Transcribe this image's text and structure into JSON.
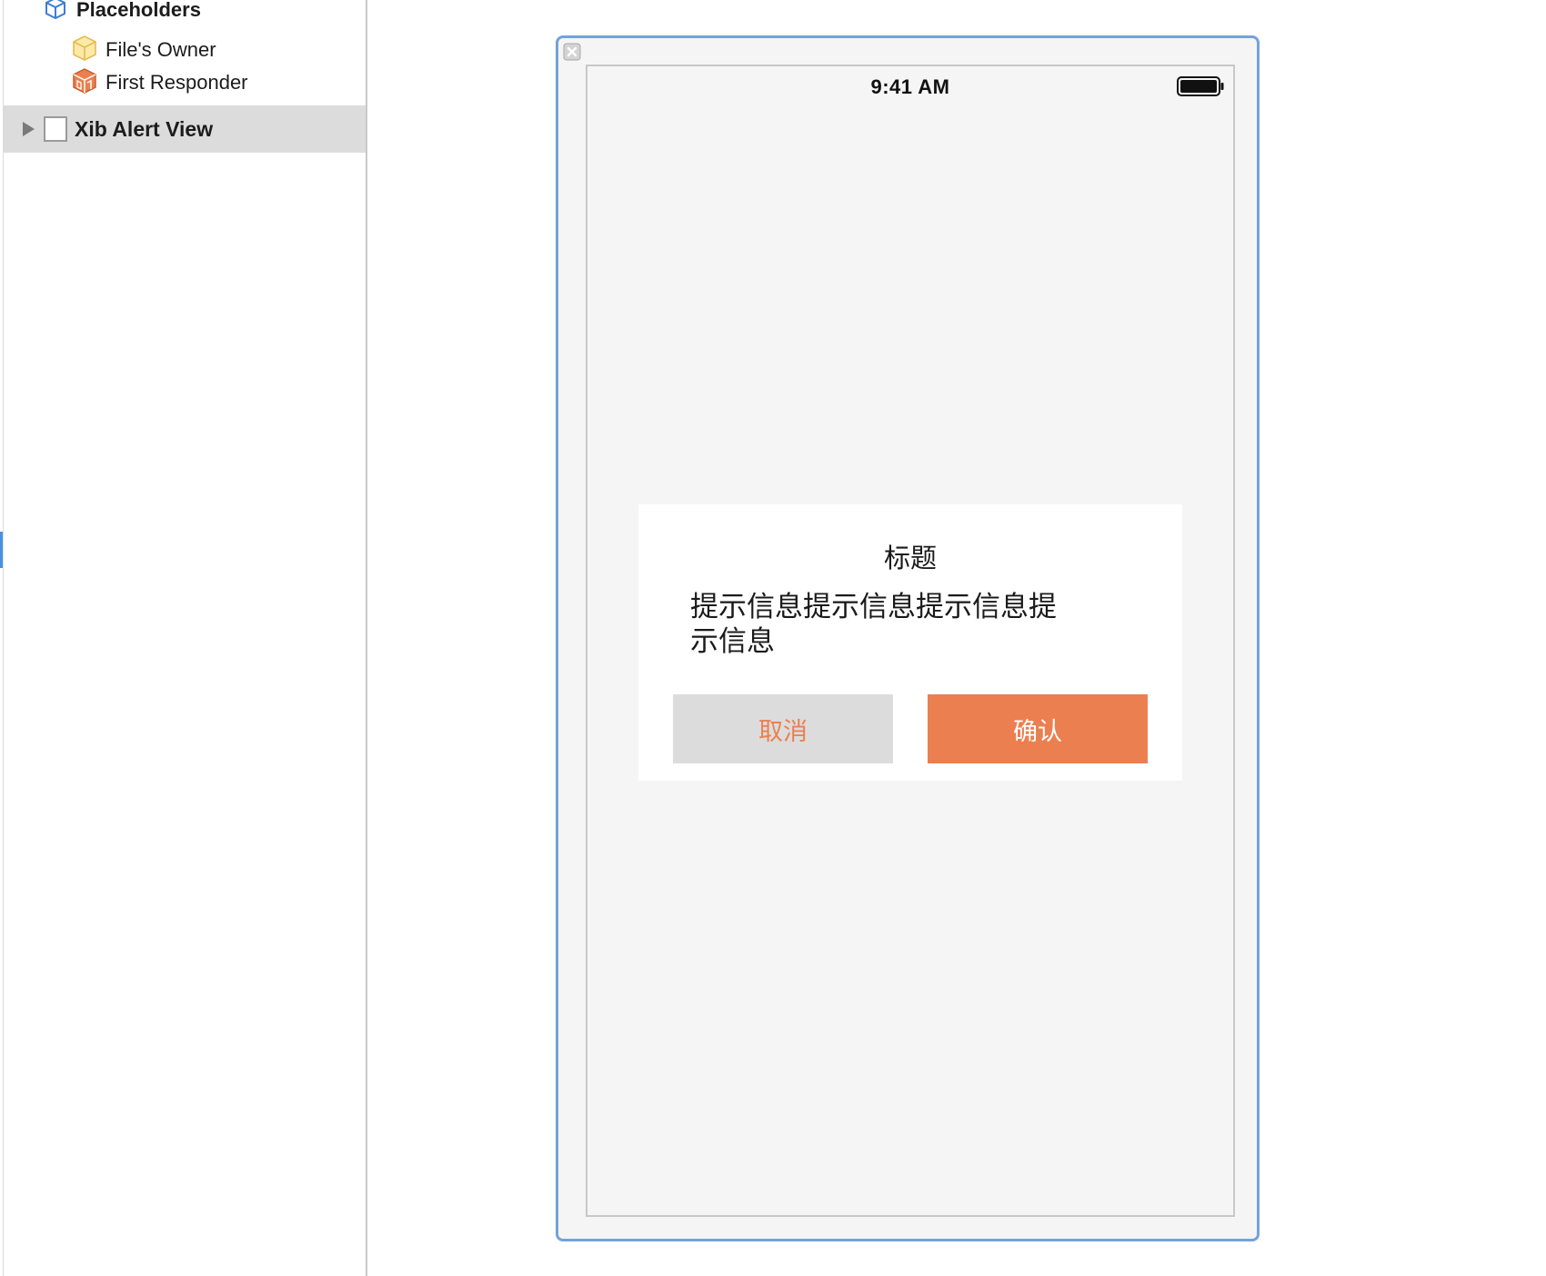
{
  "outline": {
    "placeholders_label": "Placeholders",
    "files_owner_label": "File's Owner",
    "first_responder_label": "First Responder",
    "xib_alert_view_label": "Xib Alert View"
  },
  "icons": {
    "placeholders": "cube-outline-icon",
    "files_owner": "yellow-cube-icon",
    "first_responder": "orange-cube-icon",
    "disclosure": "disclosure-triangle-icon",
    "view": "view-square-icon",
    "close": "close-icon",
    "battery": "battery-icon"
  },
  "canvas": {
    "status_time": "9:41 AM",
    "alert": {
      "title": "标题",
      "message_line1": "提示信息提示信息提示信息提",
      "message_line2": "示信息",
      "cancel_label": "取消",
      "confirm_label": "确认"
    }
  },
  "colors": {
    "accent_orange": "#ec7f4f",
    "cancel_bg": "#dcdcdc",
    "frame_blue": "#74a2dc",
    "screen_bg": "#f5f5f5",
    "selection_bg": "#dcdcdc"
  }
}
